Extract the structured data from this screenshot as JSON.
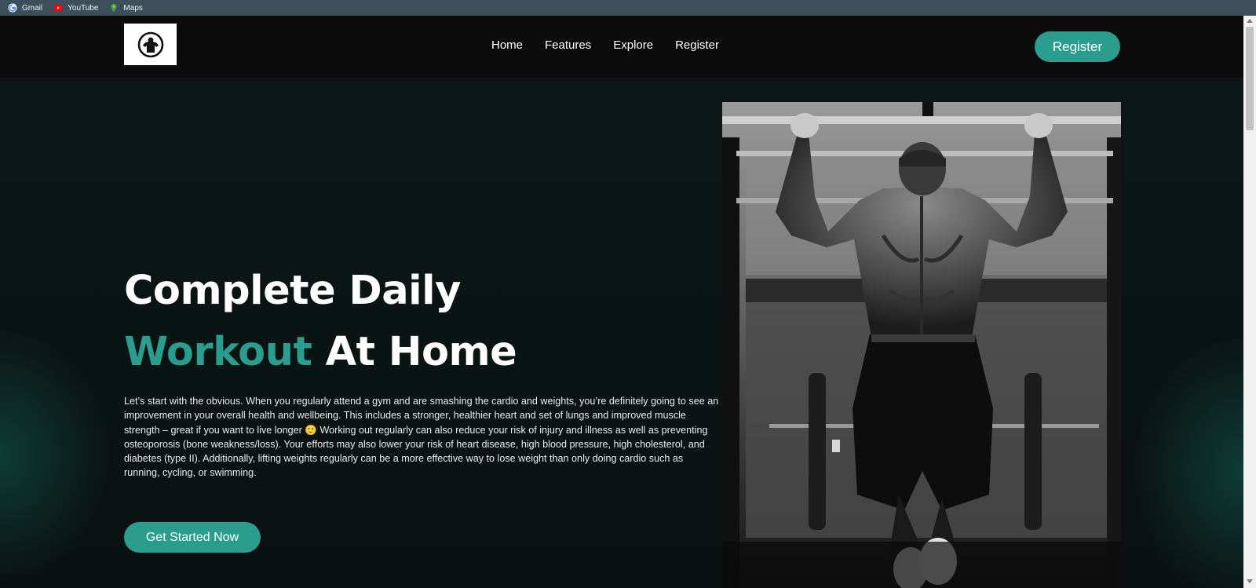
{
  "bookmarks": [
    {
      "label": "Gmail",
      "icon": "google-icon"
    },
    {
      "label": "YouTube",
      "icon": "youtube-icon"
    },
    {
      "label": "Maps",
      "icon": "maps-icon"
    }
  ],
  "header": {
    "logo_icon": "bodybuilder-logo-icon",
    "nav": [
      "Home",
      "Features",
      "Explore",
      "Register"
    ],
    "register_label": "Register"
  },
  "hero": {
    "title_line1": "Complete Daily",
    "title_accent": "Workout",
    "title_rest": " At Home",
    "body": "Let’s start with the obvious. When you regularly attend a gym and are smashing the cardio and weights, you’re definitely going to see an improvement in your overall health and wellbeing. This includes a stronger, healthier heart and set of lungs and improved muscle strength – great if you want to live longer 🙂 Working out regularly can also reduce your risk of injury and illness as well as preventing osteoporosis (bone weakness/loss). Your efforts may also lower your risk of heart disease, high blood pressure, high cholesterol, and diabetes (type II). Additionally, lifting weights regularly can be a more effective way to lose weight than only doing cardio such as running, cycling, or swimming.",
    "cta_label": "Get Started Now",
    "image_icon": "pull-up-athlete-photo"
  },
  "colors": {
    "accent": "#2a9d8f",
    "background": "#0b1413",
    "header": "#0b0b0b",
    "bookmarks_bar": "#3d4f5a"
  }
}
